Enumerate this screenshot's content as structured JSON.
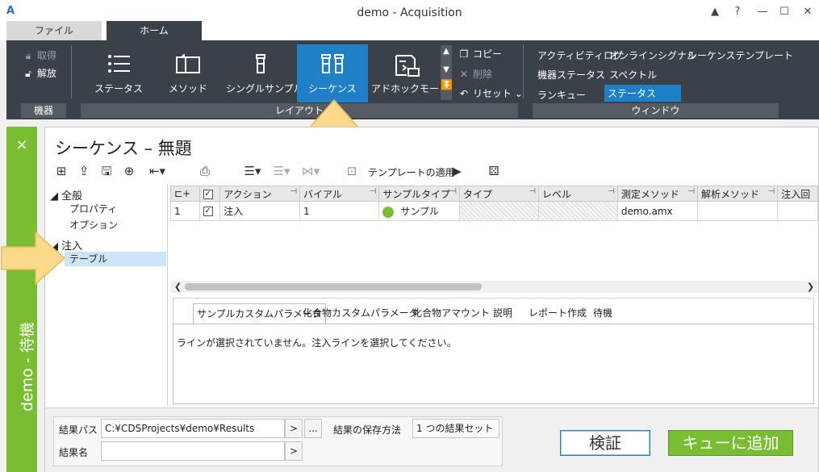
{
  "app": {
    "title": "demo - Acquisition",
    "icon_text": "A"
  },
  "window_controls": {
    "up": "▲",
    "help": "?",
    "minimize": "—",
    "maximize": "☐",
    "close": "✕"
  },
  "tabs": {
    "file": "ファイル",
    "home": "ホーム"
  },
  "ribbon": {
    "instrument": {
      "acquire": "取得",
      "release": "解放",
      "group": "機器"
    },
    "layout": {
      "status": "ステータス",
      "method": "メソッド",
      "single_sample": "シングルサンプル",
      "sequence": "シーケンス",
      "adhoc": "アドホックモード",
      "copy": "コピー",
      "delete": "削除",
      "reset": "リセット",
      "group": "レイアウト"
    },
    "window": {
      "activity_log": "アクティビティログ",
      "online_signal": "オンラインシグナル",
      "sequence_template": "シーケンステンプレート",
      "instrument_status": "機器ステータス",
      "spectrum": "スペクトル",
      "run_queue": "ランキュー",
      "status": "ステータス",
      "group": "ウィンドウ"
    }
  },
  "strip": {
    "text": "demo - 待機",
    "close": "×"
  },
  "main": {
    "title": "シーケンス – 無題",
    "apply_template": "テンプレートの適用"
  },
  "tree": {
    "general": "全般",
    "properties": "プロパティ",
    "options": "オプション",
    "injection": "注入",
    "table": "テーブル"
  },
  "grid": {
    "columns": [
      "アクション",
      "バイアル",
      "サンプルタイプ",
      "タイプ",
      "レベル",
      "測定メソッド",
      "解析メソッド",
      "注入回"
    ],
    "rows": [
      {
        "num": "1",
        "checked": "✓",
        "action": "注入",
        "vial": "1",
        "sample_type": "サンプル",
        "type": "",
        "level": "",
        "acq_method": "demo.amx",
        "proc_method": "",
        "inj": ""
      }
    ]
  },
  "bottom_tabs": [
    "サンプルカスタムパラメータ",
    "化合物カスタムパラメータ",
    "化合物アマウント",
    "説明",
    "レポート作成",
    "待機"
  ],
  "panel_message": "ラインが選択されていません。注入ラインを選択してください。",
  "footer": {
    "result_path_label": "結果パス",
    "result_path": "C:¥CDSProjects¥demo¥Results",
    "result_name_label": "結果名",
    "result_name": "",
    "save_method_label": "結果の保存方法",
    "save_method": "1 つの結果セット",
    "browse": ">",
    "more": "...",
    "verify": "検証",
    "add_to_queue": "キューに追加"
  },
  "colors": {
    "ribbon_bg": "#3b4149",
    "accent": "#1f7fc7",
    "status_green": "#79be32",
    "arrow": "#fdd98b"
  }
}
